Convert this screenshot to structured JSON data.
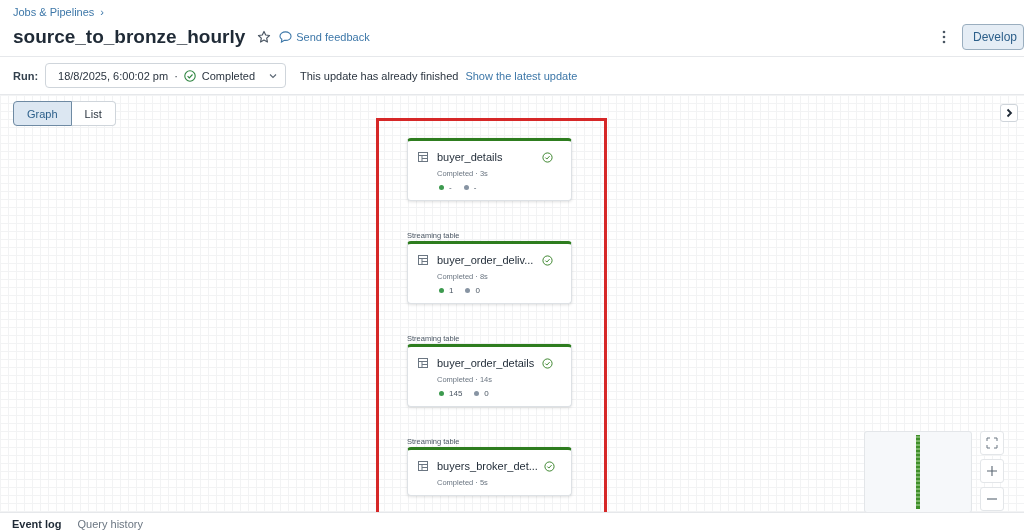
{
  "breadcrumb": {
    "label": "Jobs & Pipelines",
    "separator": "›"
  },
  "title": "source_to_bronze_hourly",
  "starred": false,
  "feedback": "Send feedback",
  "primary_button": "Develop",
  "run": {
    "label": "Run:",
    "datetime": "18/8/2025, 6:00:02 pm",
    "separator": "·",
    "status": "Completed",
    "message": "This update has already finished",
    "link": "Show the latest update"
  },
  "view_toggle": [
    {
      "label": "Graph",
      "selected": true
    },
    {
      "label": "List",
      "selected": false
    }
  ],
  "nodes": [
    {
      "name": "buyer_details",
      "completed": true,
      "status_text": "Completed · 3s",
      "metrics": [
        {
          "value": "-",
          "color": "#3d9a4f"
        },
        {
          "value": "-",
          "color": "#8794a3"
        }
      ]
    },
    {
      "type_label": "Streaming table",
      "name": "buyer_order_deliv...",
      "completed": true,
      "status_text": "Completed · 8s",
      "metrics": [
        {
          "value": "1",
          "color": "#3d9a4f"
        },
        {
          "value": "0",
          "color": "#8794a3"
        }
      ]
    },
    {
      "type_label": "Streaming table",
      "name": "buyer_order_details",
      "completed": true,
      "status_text": "Completed · 14s",
      "metrics": [
        {
          "value": "145",
          "color": "#3d9a4f"
        },
        {
          "value": "0",
          "color": "#8794a3"
        }
      ]
    },
    {
      "type_label": "Streaming table",
      "name": "buyers_broker_det...",
      "completed": true,
      "status_text": "Completed · 5s"
    }
  ],
  "bottom_tabs": [
    {
      "label": "Event log",
      "selected": true
    },
    {
      "label": "Query history",
      "selected": false
    }
  ]
}
